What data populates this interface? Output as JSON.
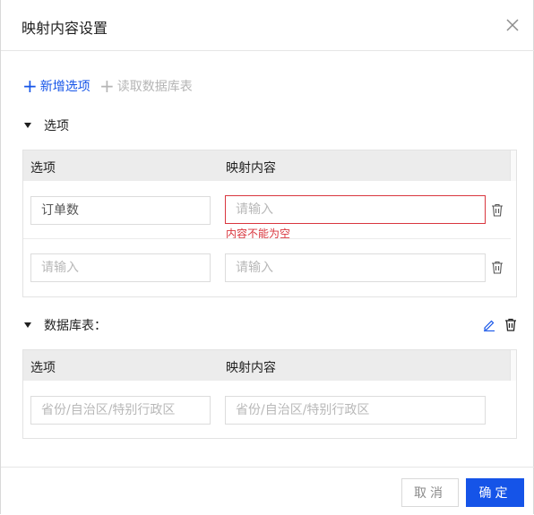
{
  "dialog": {
    "title": "映射内容设置",
    "close_icon": "close-icon"
  },
  "toolbar": {
    "add_label": "新增选项",
    "read_label": "读取数据库表"
  },
  "options_section": {
    "title": "选项",
    "columns": [
      "选项",
      "映射内容"
    ],
    "rows": [
      {
        "option_value": "订单数",
        "mapping_placeholder": "请输入",
        "error": "内容不能为空"
      },
      {
        "option_placeholder": "请输入",
        "mapping_placeholder": "请输入"
      }
    ]
  },
  "database_section": {
    "title": "数据库表：",
    "columns": [
      "选项",
      "映射内容"
    ],
    "rows": [
      {
        "option_placeholder": "省份/自治区/特别行政区",
        "mapping_placeholder": "省份/自治区/特别行政区"
      }
    ]
  },
  "footer": {
    "cancel_label": "取消",
    "ok_label": "确定"
  },
  "colors": {
    "primary": "#1554e8",
    "error": "#d9363e"
  }
}
